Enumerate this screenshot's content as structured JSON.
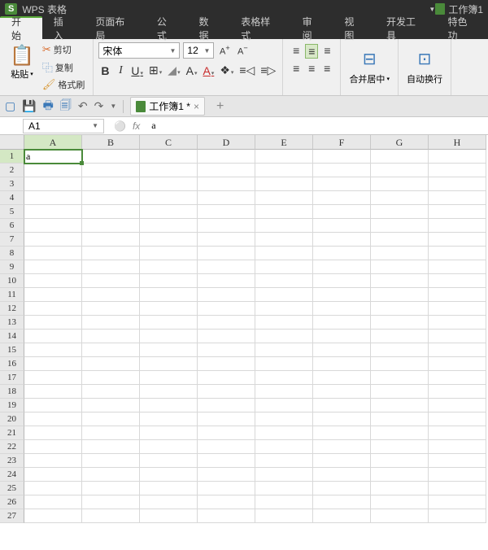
{
  "titlebar": {
    "logo": "S",
    "title": "WPS 表格",
    "workbook": "工作簿1"
  },
  "menu": {
    "tabs": [
      "开始",
      "插入",
      "页面布局",
      "公式",
      "数据",
      "表格样式",
      "审阅",
      "视图",
      "开发工具",
      "特色功"
    ],
    "active": 0
  },
  "ribbon": {
    "paste": {
      "label": "粘贴",
      "cut": "剪切",
      "copy": "复制",
      "format_painter": "格式刷"
    },
    "font": {
      "name": "宋体",
      "size": "12",
      "inc": "A⁺",
      "dec": "A⁻"
    },
    "merge": {
      "label": "合并居中"
    },
    "wrap": {
      "label": "自动换行"
    }
  },
  "qat": {
    "doc_name": "工作簿1 *"
  },
  "formula": {
    "cell_ref": "A1",
    "fx": "fx",
    "value": "a"
  },
  "columns": [
    "A",
    "B",
    "C",
    "D",
    "E",
    "F",
    "G",
    "H"
  ],
  "rows": [
    "1",
    "2",
    "3",
    "4",
    "5",
    "6",
    "7",
    "8",
    "9",
    "10",
    "11",
    "12",
    "13",
    "14",
    "15",
    "16",
    "17",
    "18",
    "19",
    "20",
    "21",
    "22",
    "23",
    "24",
    "25",
    "26",
    "27"
  ],
  "active_cell": {
    "row": 0,
    "col": 0
  },
  "cells": {
    "A1": "a"
  }
}
